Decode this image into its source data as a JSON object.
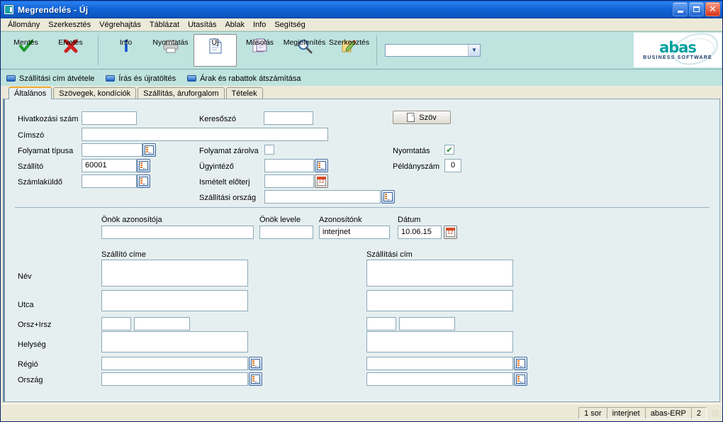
{
  "window": {
    "title": "Megrendelés - Új",
    "app_icon": "abas-app-icon",
    "minimize": "–",
    "maximize": "▫",
    "close": "✕"
  },
  "menu": {
    "items": [
      {
        "label": "Állomány"
      },
      {
        "label": "Szerkesztés"
      },
      {
        "label": "Végrehajtás"
      },
      {
        "label": "Táblázat"
      },
      {
        "label": "Utasítás"
      },
      {
        "label": "Ablak"
      },
      {
        "label": "Info"
      },
      {
        "label": "Segítség"
      }
    ]
  },
  "toolbar": {
    "buttons": [
      {
        "label": "Mentés",
        "icon": "green-check-icon",
        "active": false
      },
      {
        "label": "Elvetés",
        "icon": "red-x-icon",
        "active": false
      },
      {
        "label": "Info",
        "icon": "info-i-icon",
        "active": false
      },
      {
        "label": "Nyomtatás",
        "icon": "printer-icon",
        "active": false
      },
      {
        "label": "Új",
        "icon": "new-document-icon",
        "active": true
      },
      {
        "label": "Másolás",
        "icon": "copy-documents-icon",
        "active": false
      },
      {
        "label": "Megjelenítés",
        "icon": "magnifier-icon",
        "active": false
      },
      {
        "label": "Szerkesztés",
        "icon": "edit-pencil-icon",
        "active": false
      }
    ],
    "combo_value": "",
    "combo_arrow": "▼",
    "logo_word": "abas",
    "logo_sub": "BUSINESS SOFTWARE"
  },
  "actionbar": {
    "items": [
      {
        "label": "Szállítási cím átvétele",
        "icon": "blue-button-icon"
      },
      {
        "label": "Írás és újratöltés",
        "icon": "blue-button-icon"
      },
      {
        "label": "Árak és rabattok átszámítása",
        "icon": "blue-button-icon"
      }
    ]
  },
  "tabs": [
    {
      "label": "Általános",
      "active": true
    },
    {
      "label": "Szövegek, kondíciók",
      "active": false
    },
    {
      "label": "Szállítás, áruforgalom",
      "active": false
    },
    {
      "label": "Tételek",
      "active": false
    }
  ],
  "form": {
    "left": {
      "hivatkozasi_szam": {
        "label": "Hivatkozási szám",
        "value": ""
      },
      "cimszo": {
        "label": "Címszó",
        "value": ""
      },
      "folyamat_tipusa": {
        "label": "Folyamat típusa",
        "value": ""
      },
      "szallito": {
        "label": "Szállító",
        "value": "60001"
      },
      "szamlakuldo": {
        "label": "Számlaküldő",
        "value": ""
      }
    },
    "mid": {
      "keresoszo": {
        "label": "Keresőszó",
        "value": ""
      },
      "folyamat_zarolva": {
        "label": "Folyamat zárolva",
        "checked": false
      },
      "ugyintezo": {
        "label": "Ügyintéző",
        "value": ""
      },
      "ismetelt_eloterj": {
        "label": "Ismételt előterj",
        "value": ""
      },
      "szallitasi_orszag": {
        "label": "Szállítási ország",
        "value": ""
      }
    },
    "right": {
      "szov_button": {
        "label": "Szöv",
        "icon": "document-icon"
      },
      "nyomtatas": {
        "label": "Nyomtatás",
        "checked": true
      },
      "peldanyszam": {
        "label": "Példányszám",
        "value": "0"
      }
    },
    "ids": {
      "onok_azonositoja": {
        "label": "Önök azonosítója",
        "value": ""
      },
      "onok_levele": {
        "label": "Önök levele",
        "value": ""
      },
      "azonositonk": {
        "label": "Azonosítónk",
        "value": "interjnet"
      },
      "datum": {
        "label": "Dátum",
        "value": "10.06.15"
      }
    },
    "address": {
      "col1_title": "Szállító címe",
      "col2_title": "Szállítási cím",
      "rows": [
        {
          "label": "Név",
          "left": "",
          "right": "",
          "type": "tall"
        },
        {
          "label": "Utca",
          "left": "",
          "right": "",
          "type": "tall"
        },
        {
          "label": "Orsz+Irsz",
          "left": "",
          "left2": "",
          "right": "",
          "right2": "",
          "type": "split"
        },
        {
          "label": "Helység",
          "left": "",
          "right": "",
          "type": "tall"
        },
        {
          "label": "Régió",
          "left": "",
          "right": "",
          "type": "pick"
        },
        {
          "label": "Ország",
          "left": "",
          "right": "",
          "type": "pick"
        }
      ]
    }
  },
  "statusbar": {
    "cells": [
      "1 sor",
      "interjnet",
      "abas-ERP",
      "2"
    ]
  },
  "colors": {
    "title_blue": "#0a5fd0",
    "toolbar_teal": "#bfe3df",
    "panel_bg": "#e6eff0",
    "accent_orange": "#f0a830",
    "logo_teal": "#00a0a0"
  }
}
